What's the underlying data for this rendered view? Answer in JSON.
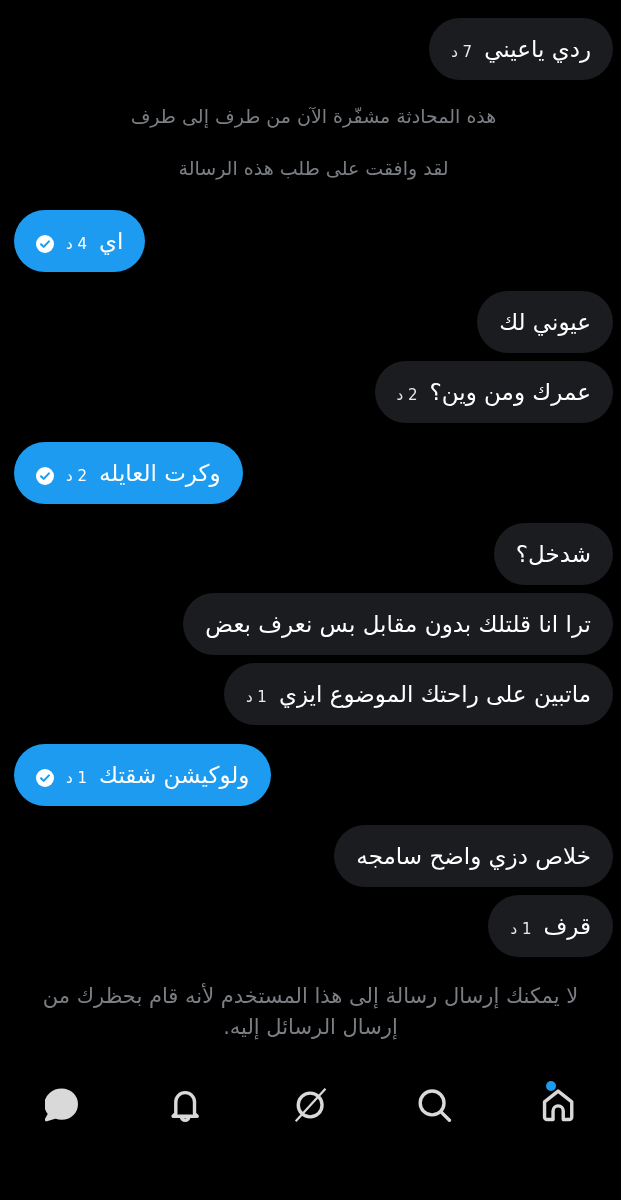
{
  "messages": [
    {
      "kind": "incoming",
      "text": "ردي ياعيني",
      "time": "7 د"
    },
    {
      "kind": "notice",
      "text": "هذه المحادثة مشفّرة الآن من طرف إلى طرف"
    },
    {
      "kind": "notice",
      "text": "لقد وافقت على طلب هذه الرسالة"
    },
    {
      "kind": "outgoing",
      "text": "اي",
      "time": "4 د",
      "read": true
    },
    {
      "kind": "incoming",
      "text": "عيوني لك"
    },
    {
      "kind": "incoming",
      "text": "عمرك ومن وين؟",
      "time": "2 د"
    },
    {
      "kind": "outgoing",
      "text": "وكرت العايله",
      "time": "2 د",
      "read": true
    },
    {
      "kind": "incoming",
      "text": "شدخل؟"
    },
    {
      "kind": "incoming",
      "text": "ترا انا قلتلك بدون مقابل بس نعرف بعض"
    },
    {
      "kind": "incoming",
      "text": "ماتبين على راحتك الموضوع ايزي",
      "time": "1 د"
    },
    {
      "kind": "outgoing",
      "text": "ولوكيشن شقتك",
      "time": "1 د",
      "read": true
    },
    {
      "kind": "incoming",
      "text": "خلاص دزي واضح سامجه"
    },
    {
      "kind": "incoming",
      "text": "قرف",
      "time": "1 د"
    }
  ],
  "blocked_notice": "لا يمكنك إرسال رسالة إلى هذا المستخدم لأنه قام بحظرك من إرسال الرسائل إليه.",
  "bottom_nav": [
    {
      "kind": "home",
      "selected": false,
      "unread": true
    },
    {
      "kind": "search",
      "selected": false,
      "unread": false
    },
    {
      "kind": "explore",
      "selected": false,
      "unread": false
    },
    {
      "kind": "notifications",
      "selected": false,
      "unread": false
    },
    {
      "kind": "messages",
      "selected": true,
      "unread": false
    }
  ]
}
